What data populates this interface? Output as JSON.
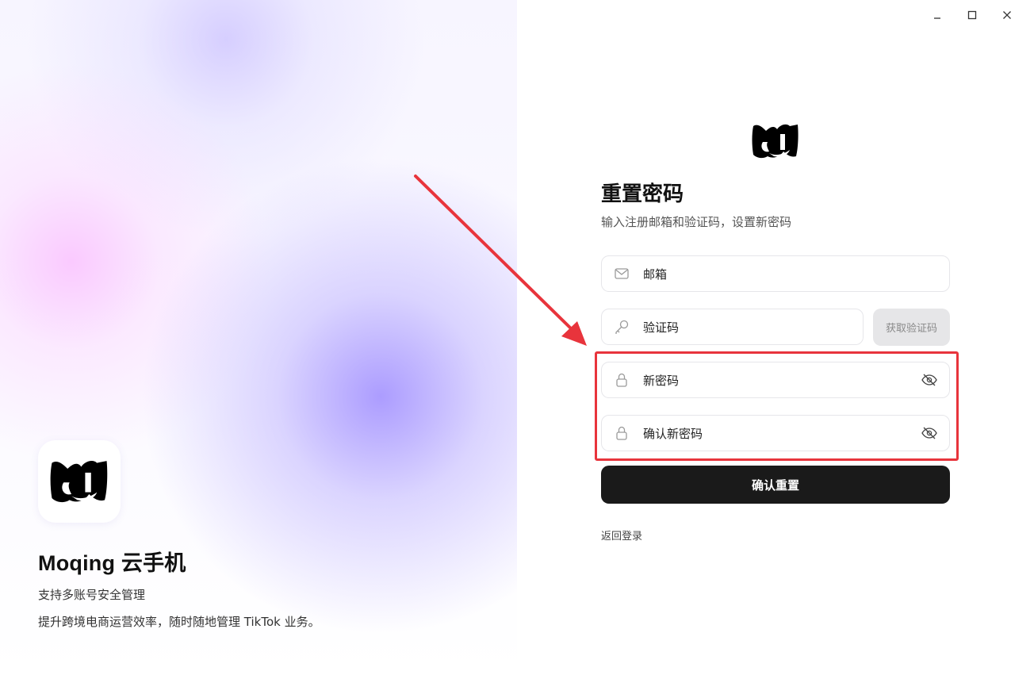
{
  "window": {
    "controls": {
      "minimize": "_",
      "maximize": "☐",
      "close": "✕"
    }
  },
  "left": {
    "app_name": "Moqing 云手机",
    "tagline": "支持多账号安全管理",
    "description": "提升跨境电商运营效率，随时随地管理 TikTok 业务。"
  },
  "form": {
    "title": "重置密码",
    "subtitle": "输入注册邮箱和验证码，设置新密码",
    "email_placeholder": "邮箱",
    "code_placeholder": "验证码",
    "get_code_label": "获取验证码",
    "new_password_placeholder": "新密码",
    "confirm_password_placeholder": "确认新密码",
    "submit_label": "确认重置",
    "back_label": "返回登录"
  },
  "colors": {
    "accent_dark": "#1a1a1a",
    "annotation_red": "#e8343c",
    "disabled_button": "#e6e6e8"
  }
}
